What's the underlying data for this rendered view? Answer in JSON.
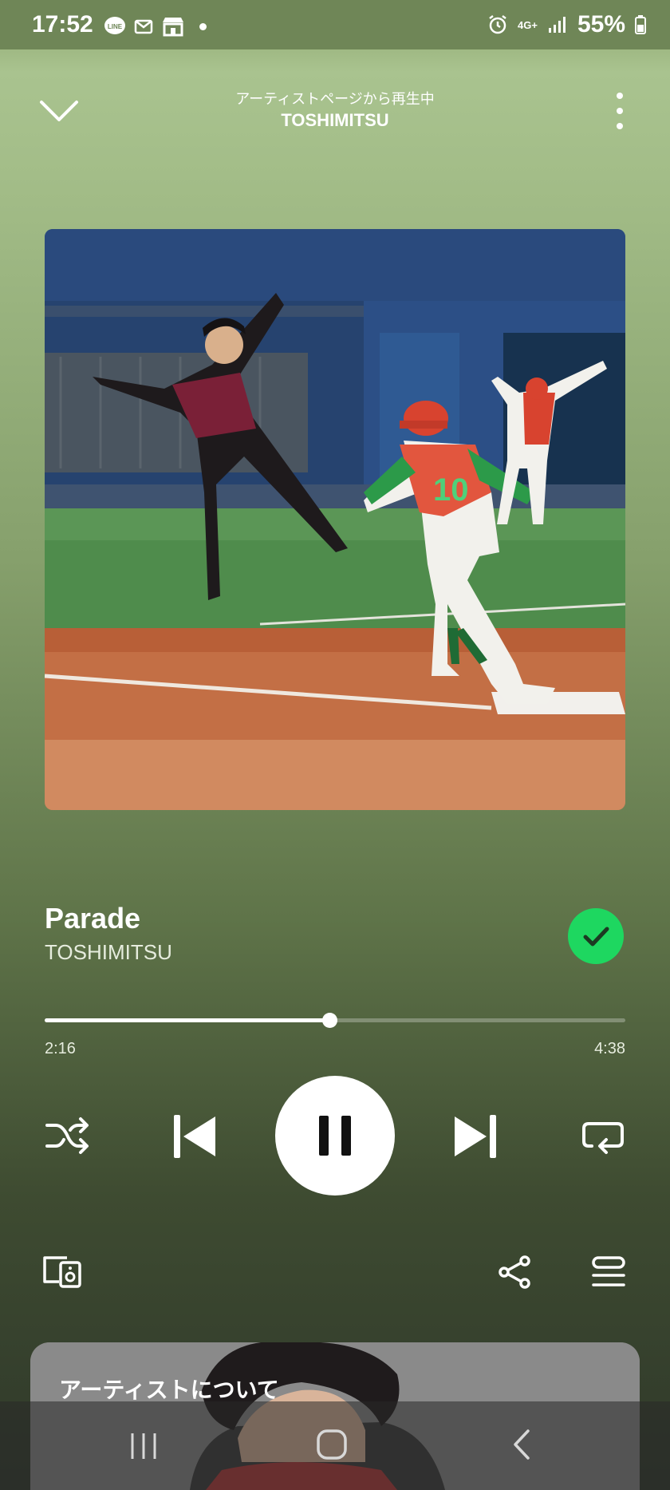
{
  "status_bar": {
    "time": "17:52",
    "battery": "55%",
    "network": "4G+",
    "notification_icons": [
      "line-icon",
      "mail-icon",
      "store-icon"
    ]
  },
  "header": {
    "context": "アーティストページから再生中",
    "title": "TOSHIMITSU"
  },
  "track": {
    "title": "Parade",
    "artist": "TOSHIMITSU",
    "liked": true
  },
  "playback": {
    "elapsed": "2:16",
    "total": "4:38",
    "progress_fraction": 0.49,
    "state": "playing"
  },
  "about": {
    "title": "アーティストについて"
  },
  "colors": {
    "accent_green": "#1ed760",
    "background_top": "#a9c38f",
    "background_bottom": "#2f382a"
  },
  "icons": {
    "shuffle": "shuffle-icon",
    "previous": "skip-previous-icon",
    "pause": "pause-icon",
    "next": "skip-next-icon",
    "repeat": "repeat-icon",
    "devices": "connect-devices-icon",
    "share": "share-icon",
    "queue": "queue-icon"
  }
}
